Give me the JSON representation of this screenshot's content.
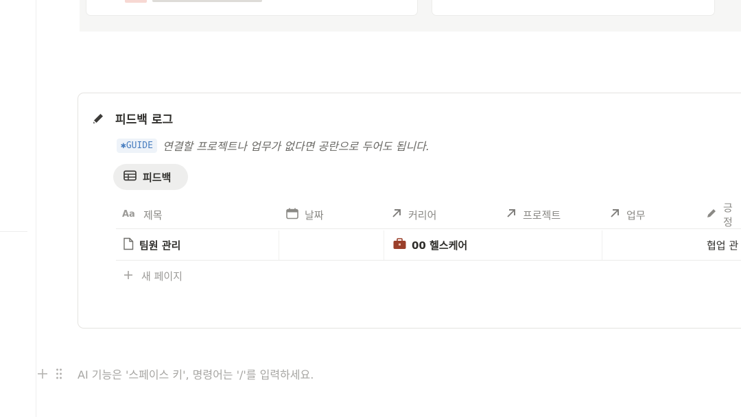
{
  "section": {
    "title": "피드백 로그",
    "guide_code": "✱GUIDE",
    "guide_text": "연결할 프로젝트나 업무가 없다면 공란으로 두어도 됩니다."
  },
  "view": {
    "label": "피드백"
  },
  "table": {
    "columns": [
      "제목",
      "날짜",
      "커리어",
      "프로젝트",
      "업무",
      "긍정"
    ],
    "rows": [
      {
        "title": "팀원 관리",
        "date": "",
        "career": "00 헬스케어",
        "project": "",
        "task": "",
        "positive": "협업 관"
      }
    ],
    "new_page": "새 페이지"
  },
  "ai_hint": "AI 기능은 '스페이스 키', 명령어는 '/'를 입력하세요.",
  "colors": {
    "accent_code": "#4a7fc0",
    "career_icon": "#9a3f2a"
  },
  "icons": {
    "title": "pencil-icon",
    "view": "table-icon",
    "col_title": "text-property-icon",
    "col_date": "calendar-icon",
    "col_relation": "arrow-up-right-icon",
    "col_positive": "pencil-icon",
    "row": "page-icon",
    "career": "briefcase-icon"
  }
}
